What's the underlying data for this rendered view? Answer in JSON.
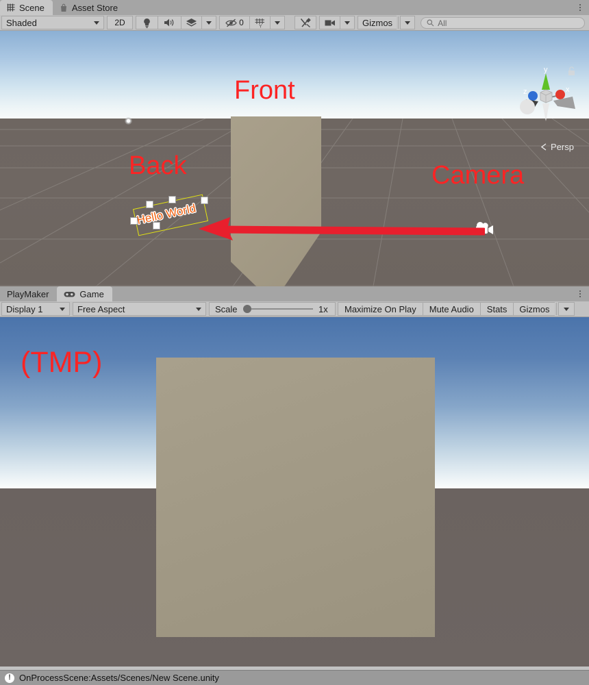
{
  "scene_panel": {
    "tabs": [
      {
        "label": "Scene",
        "icon": "grid-icon",
        "active": true
      },
      {
        "label": "Asset Store",
        "icon": "shopping-bag-icon",
        "active": false
      }
    ],
    "toolbar": {
      "draw_mode": "Shaded",
      "toggle_2d": "2D",
      "lighting_icon": "lightbulb-icon",
      "audio_icon": "speaker-icon",
      "fx_icon": "effects-layers-icon",
      "hidden_objects_icon": "eye-off-icon",
      "hidden_objects_count": "0",
      "grid_icon": "grid-visibility-icon",
      "component_tools_icon": "tools-icon",
      "camera_icon": "camera-icon",
      "gizmos_label": "Gizmos",
      "search_placeholder": "All",
      "search_value": "",
      "search_icon": "search-icon"
    },
    "viewport": {
      "nav_gizmo": {
        "axis_x": "x",
        "axis_y": "y",
        "axis_z": "z",
        "projection": "Persp",
        "lock_icon": "padlock-icon",
        "color_x": "#e33a2e",
        "color_y": "#61c126",
        "color_z": "#2f6fd4"
      },
      "selected_object_text": "Hello World",
      "selection_color": "#e3e312",
      "text_color": "#f1600f",
      "annotations": [
        {
          "label": "Front",
          "color": "#fc2424"
        },
        {
          "label": "Back",
          "color": "#fc2424"
        },
        {
          "label": "Camera",
          "color": "#fc2424"
        }
      ],
      "arrow": {
        "color": "#e81f2d",
        "direction": "left"
      },
      "camera_gizmo_icon": "camera-gizmo-icon",
      "light_gizmo_icon": "light-gizmo-icon"
    }
  },
  "game_panel": {
    "tabs": [
      {
        "label": "PlayMaker",
        "icon": "",
        "active": false
      },
      {
        "label": "Game",
        "icon": "gamepad-icon",
        "active": true
      }
    ],
    "toolbar": {
      "display": "Display 1",
      "aspect": "Free Aspect",
      "scale_label": "Scale",
      "scale_value": "1x",
      "scale_percent": 0,
      "maximize_on_play": "Maximize On Play",
      "mute_audio": "Mute Audio",
      "stats": "Stats",
      "gizmos_label": "Gizmos"
    },
    "viewport": {
      "annotations": [
        {
          "label": "(TMP)",
          "color": "#fc2424"
        }
      ]
    }
  },
  "status_bar": {
    "icon": "error-icon",
    "message": "OnProcessScene:Assets/Scenes/New Scene.unity"
  }
}
